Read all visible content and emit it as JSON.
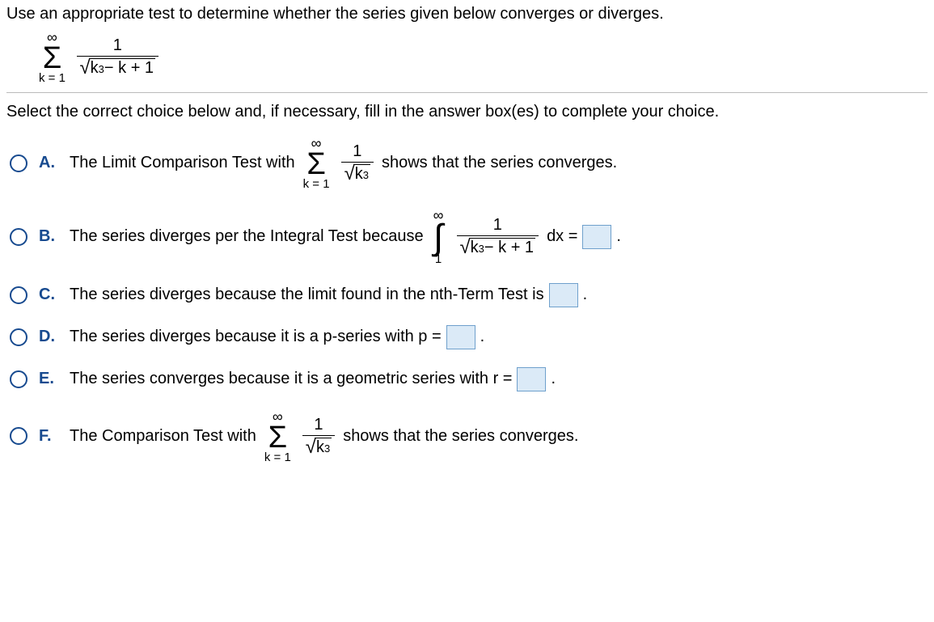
{
  "question": "Use an appropriate test to determine whether the series given below converges or diverges.",
  "main_series": {
    "sigma_top": "∞",
    "sigma_bottom": "k = 1",
    "frac_num": "1",
    "rad_base": "k",
    "rad_exp": "3",
    "rad_tail": " − k + 1"
  },
  "instruction": "Select the correct choice below and, if necessary, fill in the answer box(es) to complete your choice.",
  "choices": {
    "A": {
      "letter": "A.",
      "pre": "The Limit Comparison Test with ",
      "sigma_top": "∞",
      "sigma_bottom": "k = 1",
      "frac_num": "1",
      "rad_base": "k",
      "rad_exp": "3",
      "post": " shows that the series converges."
    },
    "B": {
      "letter": "B.",
      "pre": "The series diverges per the Integral Test because ",
      "int_top": "∞",
      "int_bottom": "1",
      "frac_num": "1",
      "rad_base": "k",
      "rad_exp": "3",
      "rad_tail": " − k + 1",
      "dx": "dx = ",
      "post": "."
    },
    "C": {
      "letter": "C.",
      "pre": "The series diverges because the limit found in the nth-Term Test is ",
      "post": "."
    },
    "D": {
      "letter": "D.",
      "pre": "The series diverges because it is a p-series with p = ",
      "post": "."
    },
    "E": {
      "letter": "E.",
      "pre": "The series converges because it is a geometric series with r = ",
      "post": "."
    },
    "F": {
      "letter": "F.",
      "pre": "The Comparison Test with ",
      "sigma_top": "∞",
      "sigma_bottom": "k = 1",
      "frac_num": "1",
      "rad_base": "k",
      "rad_exp": "3",
      "post": " shows that the series converges."
    }
  }
}
